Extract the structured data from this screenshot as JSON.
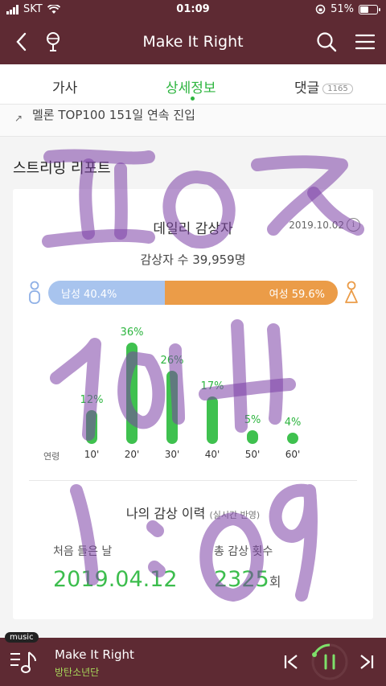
{
  "status_bar": {
    "carrier": "SKT",
    "time": "01:09",
    "battery": "51%"
  },
  "header": {
    "title": "Make It Right"
  },
  "tabs": [
    {
      "label": "가사"
    },
    {
      "label": "상세정보"
    },
    {
      "label": "댓글",
      "count": "1165"
    }
  ],
  "ranking_text": "멜론 TOP100 151일 연속 진입",
  "streaming_report": {
    "section_title": "스트리밍 리포트",
    "card_title": "데일리 감상자",
    "date": "2019.10.02",
    "listeners": "감상자 수 39,959명",
    "gender": {
      "male_label": "남성 40.4%",
      "female_label": "여성 59.6%",
      "male_fraction": 0.404
    },
    "age_axis_label": "연령",
    "ages": [
      {
        "label": "10'",
        "pct": "12%",
        "value": 12
      },
      {
        "label": "20'",
        "pct": "36%",
        "value": 36
      },
      {
        "label": "30'",
        "pct": "26%",
        "value": 26
      },
      {
        "label": "40'",
        "pct": "17%",
        "value": 17
      },
      {
        "label": "50'",
        "pct": "5%",
        "value": 5
      },
      {
        "label": "60'",
        "pct": "4%",
        "value": 4
      }
    ]
  },
  "my_history": {
    "title": "나의 감상 이력",
    "subtitle": "(실시간 반영)",
    "first_listen_label": "처음 들은 날",
    "first_listen_date": "2019.04.12",
    "total_plays_label": "총 감상 횟수",
    "total_plays_value": "2325",
    "total_plays_unit": "회"
  },
  "mini_player": {
    "tag": "music",
    "song": "Make It Right",
    "artist": "방탄소년단"
  },
  "handwriting_color": "#7b3fa6",
  "colors": {
    "brand_bar": "#5e2a33",
    "accent_green": "#2db53f",
    "male": "#a8c4ee",
    "female": "#eb9c48"
  }
}
